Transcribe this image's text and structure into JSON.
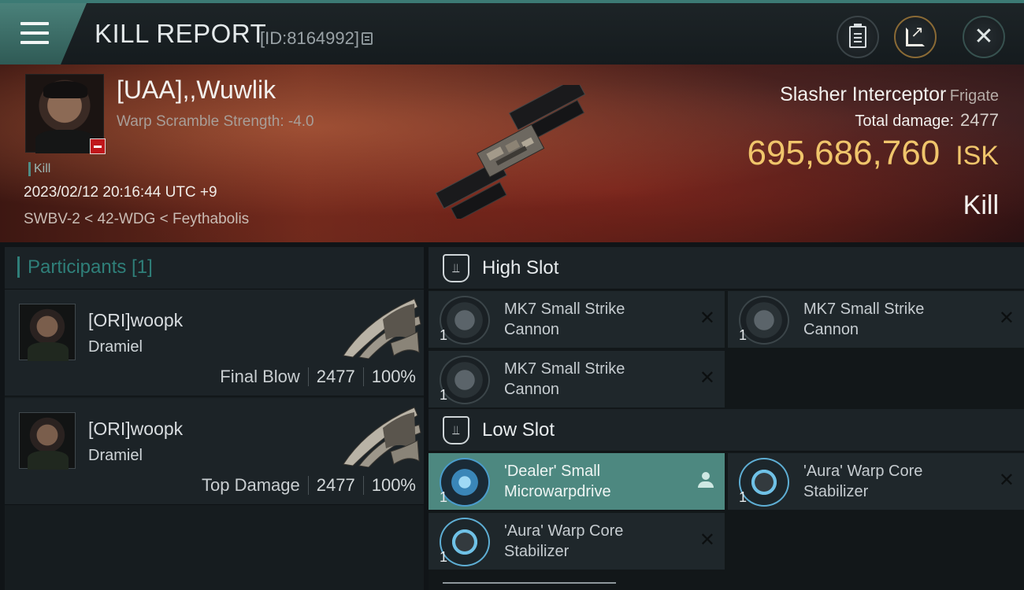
{
  "header": {
    "title": "KILL REPORT",
    "report_id": "[ID:8164992]",
    "buttons": {
      "menu": "menu-icon",
      "clipboard": "clipboard-icon",
      "share": "share-icon",
      "close": "close-icon"
    }
  },
  "victim": {
    "name": "[UAA],,Wuwlik",
    "scramble": "Warp Scramble Strength: -4.0",
    "tag": "Kill",
    "datetime": "2023/02/12 20:16:44 UTC +9",
    "location": "SWBV-2 < 42-WDG < Feythabolis",
    "ship_name": "Slasher Interceptor",
    "ship_class": "Frigate",
    "total_damage_label": "Total damage:",
    "total_damage": "2477",
    "isk_value": "695,686,760",
    "isk_unit": "ISK",
    "result": "Kill"
  },
  "participants": {
    "title": "Participants [1]",
    "rows": [
      {
        "name": "[ORI]woopk",
        "ship": "Dramiel",
        "label": "Final Blow",
        "damage": "2477",
        "percent": "100%"
      },
      {
        "name": "[ORI]woopk",
        "ship": "Dramiel",
        "label": "Top Damage",
        "damage": "2477",
        "percent": "100%"
      }
    ]
  },
  "fitting": {
    "high_slot": {
      "title": "High Slot",
      "modules": [
        {
          "name": "MK7 Small Strike Cannon",
          "qty": "1"
        },
        {
          "name": "MK7 Small Strike Cannon",
          "qty": "1"
        },
        {
          "name": "MK7 Small Strike Cannon",
          "qty": "1"
        }
      ]
    },
    "low_slot": {
      "title": "Low Slot",
      "modules": [
        {
          "name": "'Dealer' Small Microwarpdrive",
          "qty": "1"
        },
        {
          "name": "'Aura' Warp Core Stabilizer",
          "qty": "1"
        },
        {
          "name": "'Aura' Warp Core Stabilizer",
          "qty": "1"
        }
      ]
    }
  },
  "colors": {
    "accent": "#3c7a74",
    "isk": "#f0c56b",
    "active_module": "#4d8880",
    "badge": "#c0171b"
  }
}
